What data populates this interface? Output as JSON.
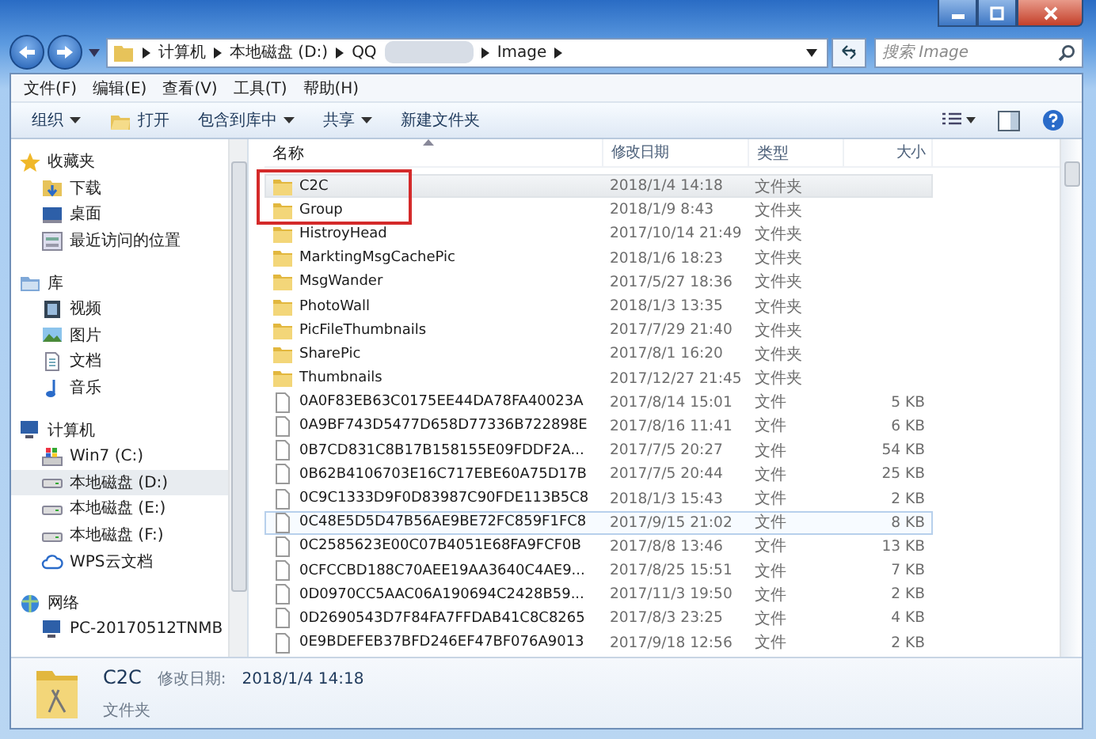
{
  "address_bar": {
    "segments": [
      "计算机",
      "本地磁盘 (D:)",
      "QQ",
      "Image"
    ]
  },
  "search": {
    "placeholder": "搜索 Image"
  },
  "menu_bar": [
    "文件(F)",
    "编辑(E)",
    "查看(V)",
    "工具(T)",
    "帮助(H)"
  ],
  "toolbar": [
    {
      "label": "组织",
      "kind": "menu"
    },
    {
      "label": "打开",
      "kind": "open"
    },
    {
      "label": "包含到库中",
      "kind": "menu"
    },
    {
      "label": "共享",
      "kind": "menu"
    },
    {
      "label": "新建文件夹",
      "kind": "plain"
    }
  ],
  "sidebar": [
    {
      "label": "收藏夹",
      "kind": "star",
      "items": [
        {
          "label": "下载",
          "kind": "download",
          "selected": false
        },
        {
          "label": "桌面",
          "kind": "desktop",
          "selected": false
        },
        {
          "label": "最近访问的位置",
          "kind": "recent",
          "selected": false
        }
      ]
    },
    {
      "label": "库",
      "kind": "library",
      "items": [
        {
          "label": "视频",
          "kind": "video",
          "selected": false
        },
        {
          "label": "图片",
          "kind": "picture",
          "selected": false
        },
        {
          "label": "文档",
          "kind": "document",
          "selected": false
        },
        {
          "label": "音乐",
          "kind": "music",
          "selected": false
        }
      ]
    },
    {
      "label": "计算机",
      "kind": "computer",
      "items": [
        {
          "label": "Win7 (C:)",
          "kind": "system-drive",
          "selected": false
        },
        {
          "label": "本地磁盘 (D:)",
          "kind": "drive",
          "selected": true
        },
        {
          "label": "本地磁盘 (E:)",
          "kind": "drive",
          "selected": false
        },
        {
          "label": "本地磁盘 (F:)",
          "kind": "drive",
          "selected": false
        },
        {
          "label": "WPS云文档",
          "kind": "cloud",
          "selected": false
        }
      ]
    },
    {
      "label": "网络",
      "kind": "network",
      "items": [
        {
          "label": "PC-20170512TNMB",
          "kind": "pc",
          "selected": false
        }
      ]
    }
  ],
  "table": {
    "columns": [
      "名称",
      "修改日期",
      "类型",
      "大小"
    ],
    "rows": [
      {
        "kind": "folder",
        "name": "C2C",
        "date": "2018/1/4 14:18",
        "type": "文件夹",
        "selected": true
      },
      {
        "kind": "folder",
        "name": "Group",
        "date": "2018/1/9 8:43",
        "type": "文件夹",
        "selected": false
      },
      {
        "kind": "folder",
        "name": "HistroyHead",
        "date": "2017/10/14 21:49",
        "type": "文件夹",
        "selected": false
      },
      {
        "kind": "folder",
        "name": "MarktingMsgCachePic",
        "date": "2018/1/6 18:23",
        "type": "文件夹",
        "selected": false
      },
      {
        "kind": "folder",
        "name": "MsgWander",
        "date": "2017/5/27 18:36",
        "type": "文件夹",
        "selected": false
      },
      {
        "kind": "folder",
        "name": "PhotoWall",
        "date": "2018/1/3 13:35",
        "type": "文件夹",
        "selected": false
      },
      {
        "kind": "folder",
        "name": "PicFileThumbnails",
        "date": "2017/7/29 21:40",
        "type": "文件夹",
        "selected": false
      },
      {
        "kind": "folder",
        "name": "SharePic",
        "date": "2017/8/1 16:20",
        "type": "文件夹",
        "selected": false
      },
      {
        "kind": "folder",
        "name": "Thumbnails",
        "date": "2017/12/27 21:45",
        "type": "文件夹",
        "selected": false
      },
      {
        "kind": "file",
        "name": "0A0F83EB63C0175EE44DA78FA40023A",
        "date": "2017/8/14 15:01",
        "type": "文件",
        "size": "5 KB",
        "selected": false
      },
      {
        "kind": "file",
        "name": "0A9BF743D5477D658D77336B722898E",
        "date": "2017/8/16 11:41",
        "type": "文件",
        "size": "6 KB",
        "selected": false
      },
      {
        "kind": "file",
        "name": "0B7CD831C8B17B158155E09FDDF2A...",
        "date": "2017/7/5 20:27",
        "type": "文件",
        "size": "54 KB",
        "selected": false
      },
      {
        "kind": "file",
        "name": "0B62B4106703E16C717EBE60A75D17B",
        "date": "2017/7/5 20:44",
        "type": "文件",
        "size": "25 KB",
        "selected": false
      },
      {
        "kind": "file",
        "name": "0C9C1333D9F0D83987C90FDE113B5C8",
        "date": "2018/1/3 15:43",
        "type": "文件",
        "size": "2 KB",
        "selected": false
      },
      {
        "kind": "file",
        "name": "0C48E5D5D47B56AE9BE72FC859F1FC8",
        "date": "2017/9/15 21:02",
        "type": "文件",
        "size": "8 KB",
        "selected": false,
        "focused": true
      },
      {
        "kind": "file",
        "name": "0C2585623E00C07B4051E68FA9FCF0B",
        "date": "2017/8/8 13:46",
        "type": "文件",
        "size": "13 KB",
        "selected": false
      },
      {
        "kind": "file",
        "name": "0CFCCBD188C70AEE19AA3640C4AE9...",
        "date": "2017/8/25 15:51",
        "type": "文件",
        "size": "7 KB",
        "selected": false
      },
      {
        "kind": "file",
        "name": "0D0970CC5AAC06A190694C2428B59...",
        "date": "2017/11/3 19:50",
        "type": "文件",
        "size": "2 KB",
        "selected": false
      },
      {
        "kind": "file",
        "name": "0D2690543D7F84FA7FFDAB41C8C8265",
        "date": "2017/8/3 23:25",
        "type": "文件",
        "size": "4 KB",
        "selected": false
      },
      {
        "kind": "file",
        "name": "0E9BDEFEB37BFD246EF47BF076A9013",
        "date": "2017/9/18 12:56",
        "type": "文件",
        "size": "2 KB",
        "selected": false
      }
    ]
  },
  "status_bar": {
    "name": "C2C",
    "date_label": "修改日期:",
    "date": "2018/1/4 14:18",
    "type": "文件夹"
  }
}
